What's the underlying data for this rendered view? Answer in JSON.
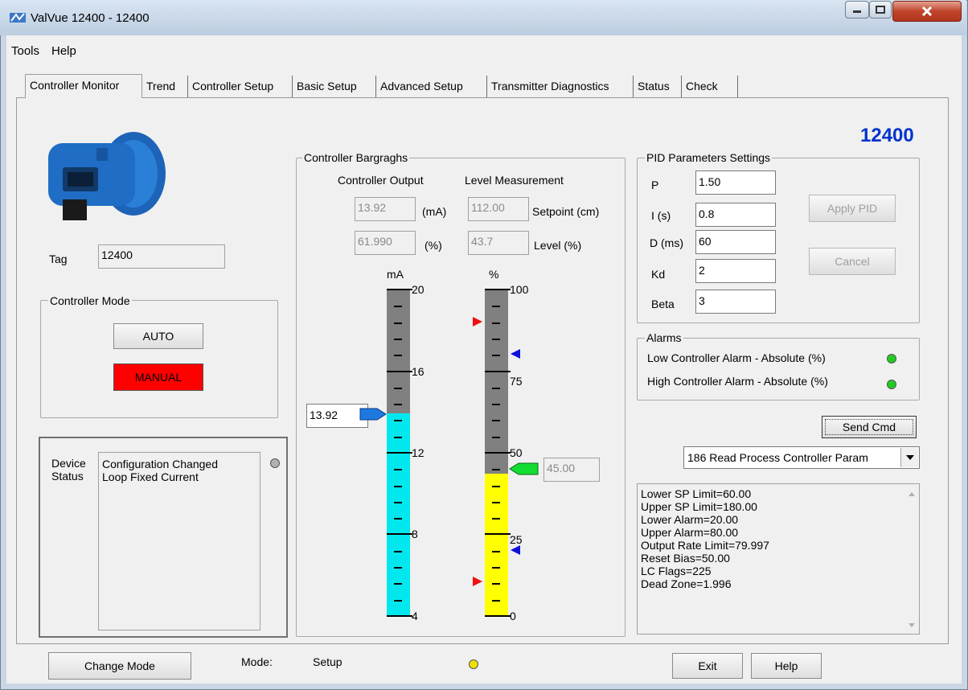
{
  "window": {
    "title": "ValVue 12400 - 12400"
  },
  "menu": [
    "Tools",
    "Help"
  ],
  "tabs": [
    "Controller Monitor",
    "Trend",
    "Controller Setup",
    "Basic Setup",
    "Advanced Setup",
    "Transmitter Diagnostics",
    "Status",
    "Check"
  ],
  "device_number": "12400",
  "tag": {
    "label": "Tag",
    "value": "12400"
  },
  "controller_mode": {
    "title": "Controller Mode",
    "auto": "AUTO",
    "manual": "MANUAL"
  },
  "device_status": {
    "label_line1": "Device",
    "label_line2": "Status",
    "messages": [
      "Configuration Changed",
      "Loop Fixed Current"
    ]
  },
  "bargraphs": {
    "title": "Controller Bargraghs",
    "output_header": "Controller Output",
    "level_header": "Level Measurement",
    "output_ma": "13.92",
    "output_ma_unit": "(mA)",
    "output_pct": "61.990",
    "output_pct_unit": "(%)",
    "setpoint": "112.00",
    "setpoint_label": "Setpoint (cm)",
    "level": "43.7",
    "level_label": "Level  (%)",
    "ma_axis": "mA",
    "pct_axis": "%",
    "ma_scale": [
      "20",
      "16",
      "12",
      "8",
      "4"
    ],
    "pct_scale": [
      "100",
      "75",
      "50",
      "25",
      "0"
    ],
    "ma_pointer_value": "13.92",
    "pct_pointer_value": "45.00",
    "ma_range": [
      4,
      20
    ],
    "ma_fill_value": 13.92,
    "pct_fill_value": 43.7,
    "fill_colors": {
      "ma": "#00e8ee",
      "pct": "#ffff00"
    }
  },
  "pid": {
    "title": "PID Parameters Settings",
    "p_label": "P",
    "p": "1.50",
    "i_label": "I  (s)",
    "i": "0.8",
    "d_label": "D (ms)",
    "d": "60",
    "kd_label": "Kd",
    "kd": "2",
    "beta_label": "Beta",
    "beta": "3",
    "apply": "Apply PID",
    "cancel": "Cancel"
  },
  "alarms": {
    "title": "Alarms",
    "low": "Low Controller Alarm - Absolute  (%)",
    "high": "High Controller Alarm - Absolute  (%)"
  },
  "command": {
    "send": "Send Cmd",
    "selected": "186 Read Process Controller Param"
  },
  "output_lines": [
    "Lower SP Limit=60.00",
    "Upper SP Limit=180.00",
    "Lower Alarm=20.00",
    "Upper Alarm=80.00",
    "Output Rate Limit=79.997",
    "Reset Bias=50.00",
    "LC Flags=225",
    "Dead Zone=1.996"
  ],
  "footer": {
    "change_mode": "Change Mode",
    "mode_label": "Mode:",
    "mode_value": "Setup",
    "exit": "Exit",
    "help": "Help"
  },
  "colors": {
    "accent_blue": "#0033cc",
    "led_green": "#22cc22",
    "led_yellow": "#f0e000",
    "manual_red": "#ff0000"
  }
}
